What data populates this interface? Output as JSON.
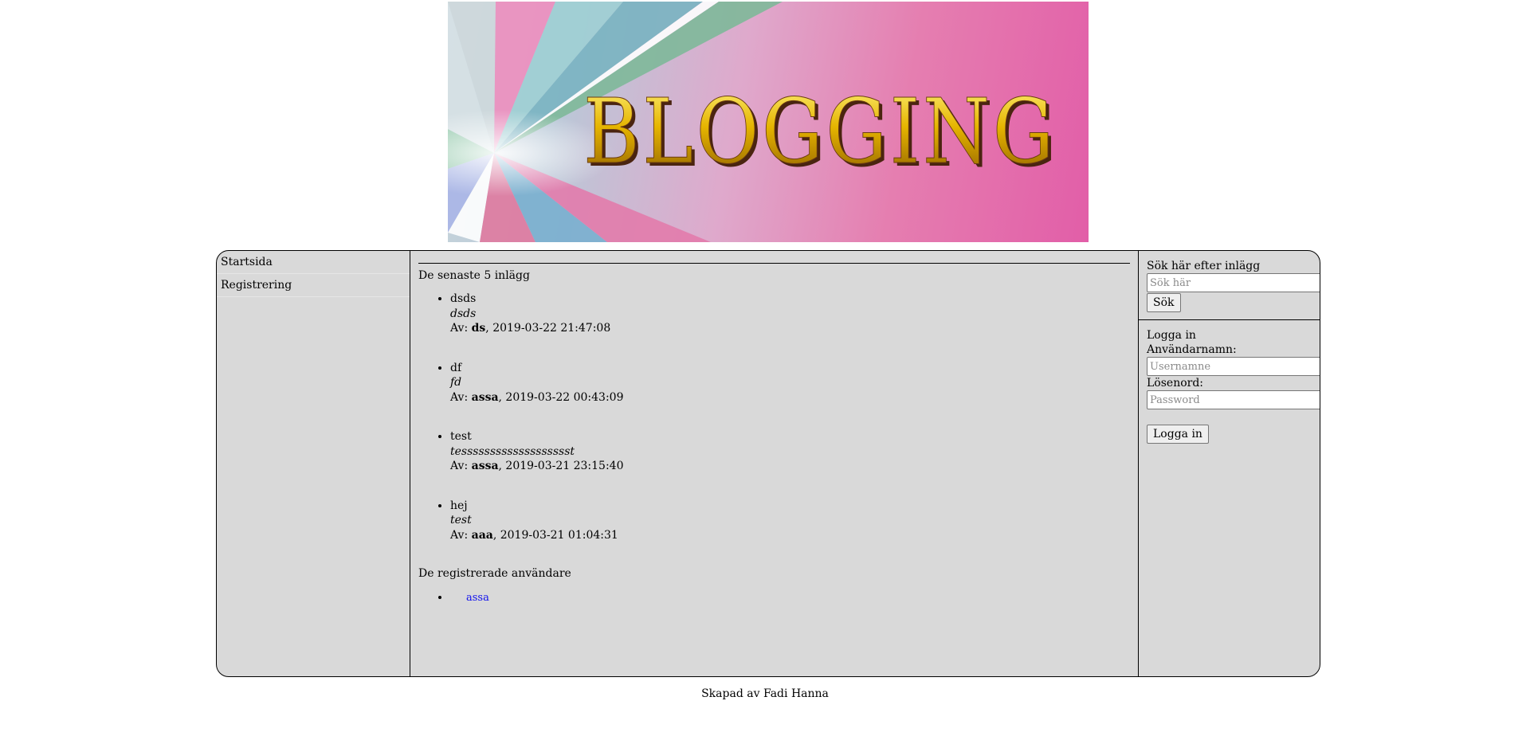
{
  "banner": {
    "title": "BLOGGING",
    "colors": {
      "background_start": "#c9d6dc",
      "background_end": "#e25ea8",
      "text_gold": "#e0b000",
      "text_shadow": "#5a2a10"
    }
  },
  "nav": {
    "items": [
      {
        "label": "Startsida"
      },
      {
        "label": "Registrering"
      }
    ]
  },
  "content": {
    "latest_title": "De senaste 5 inlägg",
    "posts": [
      {
        "title": "dsds",
        "body": "dsds",
        "by_prefix": "Av: ",
        "author": "ds",
        "date": ", 2019-03-22 21:47:08"
      },
      {
        "title": "df",
        "body": "fd",
        "by_prefix": "Av: ",
        "author": "assa",
        "date": ", 2019-03-22 00:43:09"
      },
      {
        "title": "test",
        "body": "tessssssssssssssssssst",
        "by_prefix": "Av: ",
        "author": "assa",
        "date": ", 2019-03-21 23:15:40"
      },
      {
        "title": "hej",
        "body": "test",
        "by_prefix": "Av: ",
        "author": "aaa",
        "date": ", 2019-03-21 01:04:31"
      }
    ],
    "users_title": "De registrerade användare",
    "users": [
      {
        "name": "assa"
      }
    ]
  },
  "sidebar": {
    "search": {
      "label": "Sök här efter inlägg",
      "placeholder": "Sök här",
      "button": "Sök"
    },
    "login": {
      "title": "Logga in",
      "username_label": "Användarnamn:",
      "username_placeholder": "Usernamne",
      "password_label": "Lösenord:",
      "password_placeholder": "Password",
      "button": "Logga in"
    }
  },
  "footer": {
    "text": "Skapad av Fadi Hanna"
  },
  "colors": {
    "panel_bg": "#d9d9d9",
    "link": "#1010ee"
  }
}
